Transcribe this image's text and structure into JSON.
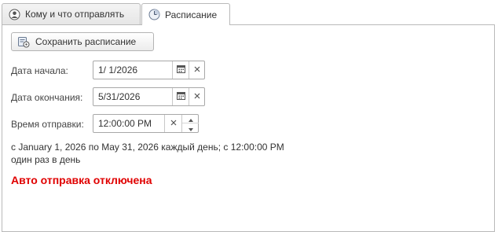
{
  "tabs": [
    {
      "label": "Кому и что отправлять",
      "icon": "user-circle-icon",
      "active": false
    },
    {
      "label": "Расписание",
      "icon": "clock-globe-icon",
      "active": true
    }
  ],
  "toolbar": {
    "save_label": "Сохранить расписание",
    "save_icon": "schedule-settings-icon"
  },
  "form": {
    "start_date": {
      "label": "Дата начала:",
      "value": "1/ 1/2026"
    },
    "end_date": {
      "label": "Дата окончания:",
      "value": "5/31/2026"
    },
    "send_time": {
      "label": "Время отправки:",
      "value": "12:00:00 PM"
    }
  },
  "summary": {
    "line1": "с January 1, 2026 по May 31, 2026 каждый день; с 12:00:00 PM",
    "line2": "один раз в день"
  },
  "status": {
    "text": "Авто отправка отключена",
    "color": "#e00000"
  },
  "colors": {
    "border": "#b9b9b9",
    "accent": "#e00000"
  }
}
